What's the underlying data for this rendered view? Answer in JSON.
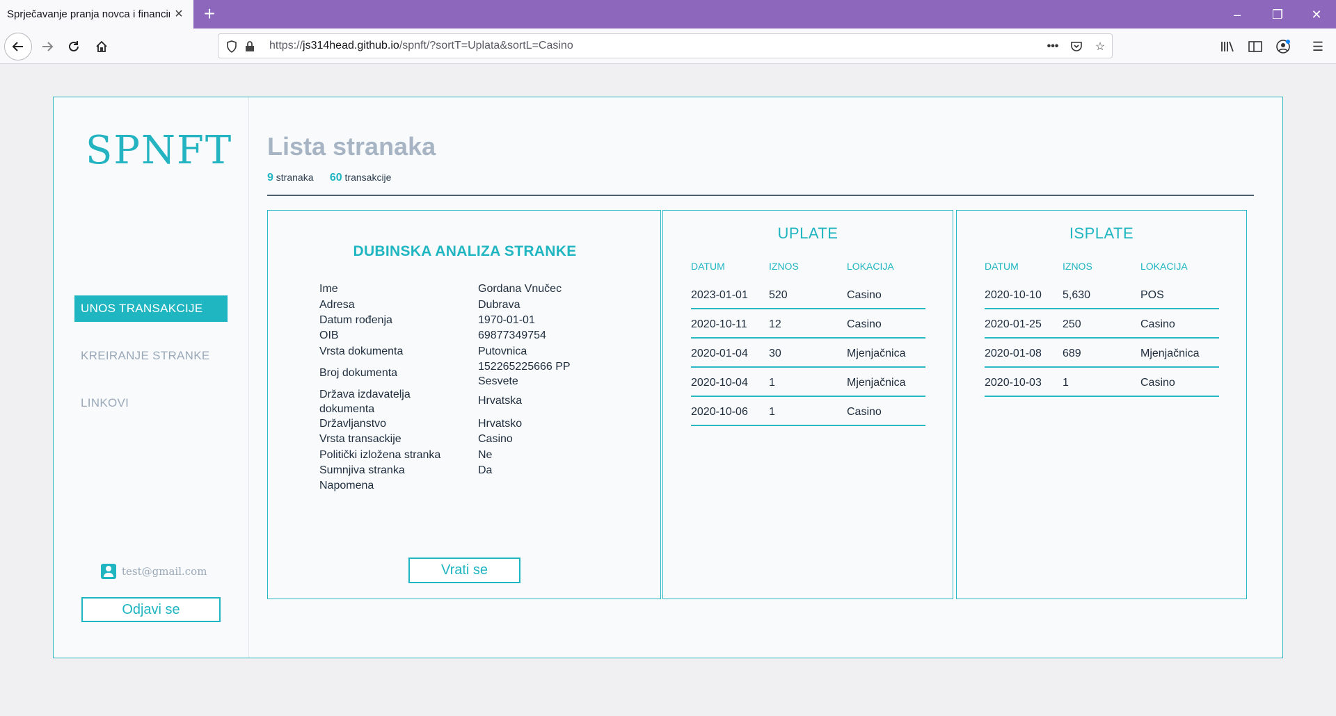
{
  "browser": {
    "tab_title": "Sprječavanje pranja novca i financir",
    "url_prefix": "https://",
    "url_host": "js314head.github.io",
    "url_path": "/spnft/?sortT=Uplata&sortL=Casino"
  },
  "sidebar": {
    "logo": "SPNFT",
    "nav": [
      {
        "label": "UNOS TRANSAKCIJE"
      },
      {
        "label": "KREIRANJE STRANKE"
      },
      {
        "label": "LINKOVI"
      }
    ],
    "user_email": "test@gmail.com",
    "logout_label": "Odjavi se"
  },
  "header": {
    "title": "Lista stranaka",
    "clients_count": "9",
    "clients_label": "stranaka",
    "transactions_count": "60",
    "transactions_label": "transakcije"
  },
  "detail": {
    "title": "DUBINSKA ANALIZA STRANKE",
    "rows": [
      {
        "label": "Ime",
        "value": "Gordana Vnučec"
      },
      {
        "label": "Adresa",
        "value": "Dubrava"
      },
      {
        "label": "Datum rođenja",
        "value": "1970-01-01"
      },
      {
        "label": "OIB",
        "value": "69877349754"
      },
      {
        "label": "Vrsta dokumenta",
        "value": "Putovnica"
      },
      {
        "label": "Broj dokumenta",
        "value": "152265225666 PP Sesvete"
      },
      {
        "label": "Država izdavatelja dokumenta",
        "value": "Hrvatska"
      },
      {
        "label": "Državljanstvo",
        "value": "Hrvatsko"
      },
      {
        "label": "Vrsta transackije",
        "value": "Casino"
      },
      {
        "label": "Politički izložena stranka",
        "value": "Ne"
      },
      {
        "label": "Sumnjiva stranka",
        "value": "Da"
      },
      {
        "label": "Napomena",
        "value": ""
      }
    ],
    "back_label": "Vrati se"
  },
  "uplate": {
    "title": "UPLATE",
    "columns": [
      "DATUM",
      "IZNOS",
      "LOKACIJA"
    ],
    "rows": [
      {
        "datum": "2023-01-01",
        "iznos": "520",
        "lokacija": "Casino"
      },
      {
        "datum": "2020-10-11",
        "iznos": "12",
        "lokacija": "Casino"
      },
      {
        "datum": "2020-01-04",
        "iznos": "30",
        "lokacija": "Mjenjačnica"
      },
      {
        "datum": "2020-10-04",
        "iznos": "1",
        "lokacija": "Mjenjačnica"
      },
      {
        "datum": "2020-10-06",
        "iznos": "1",
        "lokacija": "Casino"
      }
    ]
  },
  "isplate": {
    "title": "ISPLATE",
    "columns": [
      "DATUM",
      "IZNOS",
      "LOKACIJA"
    ],
    "rows": [
      {
        "datum": "2020-10-10",
        "iznos": "5,630",
        "lokacija": "POS"
      },
      {
        "datum": "2020-01-25",
        "iznos": "250",
        "lokacija": "Casino"
      },
      {
        "datum": "2020-01-08",
        "iznos": "689",
        "lokacija": "Mjenjačnica"
      },
      {
        "datum": "2020-10-03",
        "iznos": "1",
        "lokacija": "Casino"
      }
    ]
  }
}
